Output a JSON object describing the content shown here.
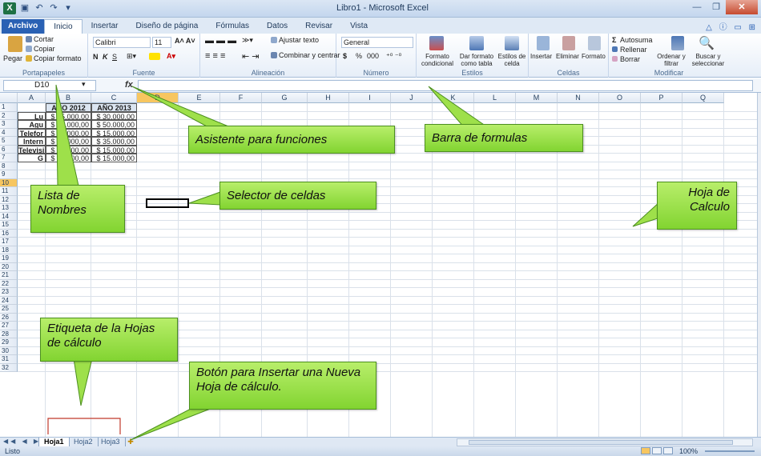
{
  "window": {
    "title": "Libro1 - Microsoft Excel",
    "app_icon": "X"
  },
  "ribbon_tabs": [
    "Archivo",
    "Inicio",
    "Insertar",
    "Diseño de página",
    "Fórmulas",
    "Datos",
    "Revisar",
    "Vista"
  ],
  "ribbon": {
    "clipboard": {
      "paste": "Pegar",
      "cut": "Cortar",
      "copy": "Copiar",
      "format_copy": "Copiar formato",
      "label": "Portapapeles"
    },
    "font": {
      "name": "Calibri",
      "size": "11",
      "bold": "N",
      "italic": "K",
      "underline": "S",
      "label": "Fuente"
    },
    "alignment": {
      "wrap": "Ajustar texto",
      "merge": "Combinar y centrar",
      "label": "Alineación"
    },
    "number": {
      "format": "General",
      "currency": "$",
      "percent": "%",
      "thousands": "000",
      "label": "Número"
    },
    "styles": {
      "conditional": "Formato condicional",
      "as_table": "Dar formato como tabla",
      "cell_styles": "Estilos de celda",
      "label": "Estilos"
    },
    "cells": {
      "insert": "Insertar",
      "delete": "Eliminar",
      "format": "Formato",
      "label": "Celdas"
    },
    "editing": {
      "autosum": "Autosuma",
      "fill": "Rellenar",
      "clear": "Borrar",
      "sort": "Ordenar y filtrar",
      "find": "Buscar y seleccionar",
      "label": "Modificar"
    }
  },
  "formula_bar": {
    "name_box": "D10",
    "fx": "fx",
    "value": ""
  },
  "columns": [
    "A",
    "B",
    "C",
    "D",
    "E",
    "F",
    "G",
    "H",
    "I",
    "J",
    "K",
    "L",
    "M",
    "N",
    "O",
    "P",
    "Q"
  ],
  "rows": [
    "1",
    "2",
    "3",
    "4",
    "5",
    "6",
    "7",
    "8",
    "9",
    "10",
    "11",
    "12",
    "13",
    "14",
    "15",
    "16",
    "17",
    "18",
    "19",
    "20",
    "21",
    "22",
    "23",
    "24",
    "25",
    "26",
    "27",
    "28",
    "29",
    "30",
    "31",
    "32"
  ],
  "table": {
    "headers": [
      "AÑO 2012",
      "AÑO 2013"
    ],
    "rows": [
      {
        "label": "Lu",
        "y2012": "$ 25.000,00",
        "y2013": "$ 30.000,00"
      },
      {
        "label": "Agu",
        "y2012": "$ 55.000,00",
        "y2013": "$ 50.000,00"
      },
      {
        "label": "Telefor",
        "y2012": "$ 10.000,00",
        "y2013": "$ 15.000,00"
      },
      {
        "label": "Intern",
        "y2012": "$ 30.000,00",
        "y2013": "$ 35.000,00"
      },
      {
        "label": "Televisi",
        "y2012": "$ 15.000,00",
        "y2013": "$ 15.000,00"
      },
      {
        "label": "G",
        "y2012": "$ 10.000,00",
        "y2013": "$ 15.000,00"
      }
    ]
  },
  "sheets": [
    "Hoja1",
    "Hoja2",
    "Hoja3"
  ],
  "status": {
    "text": "Listo",
    "zoom": "100%"
  },
  "callouts": {
    "functions": "Asistente para funciones",
    "formula_bar": "Barra de formulas",
    "names_list": "Lista de Nombres",
    "cell_selector": "Selector de celdas",
    "worksheet": "Hoja de Calculo",
    "sheet_tabs": "Etiqueta de la Hojas de cálculo",
    "insert_sheet": "Botón para Insertar una Nueva Hoja de cálculo."
  },
  "colors": {
    "file_tab": "#2a61b4",
    "callout": "#9ee04a",
    "selected_header": "#f7c660"
  }
}
